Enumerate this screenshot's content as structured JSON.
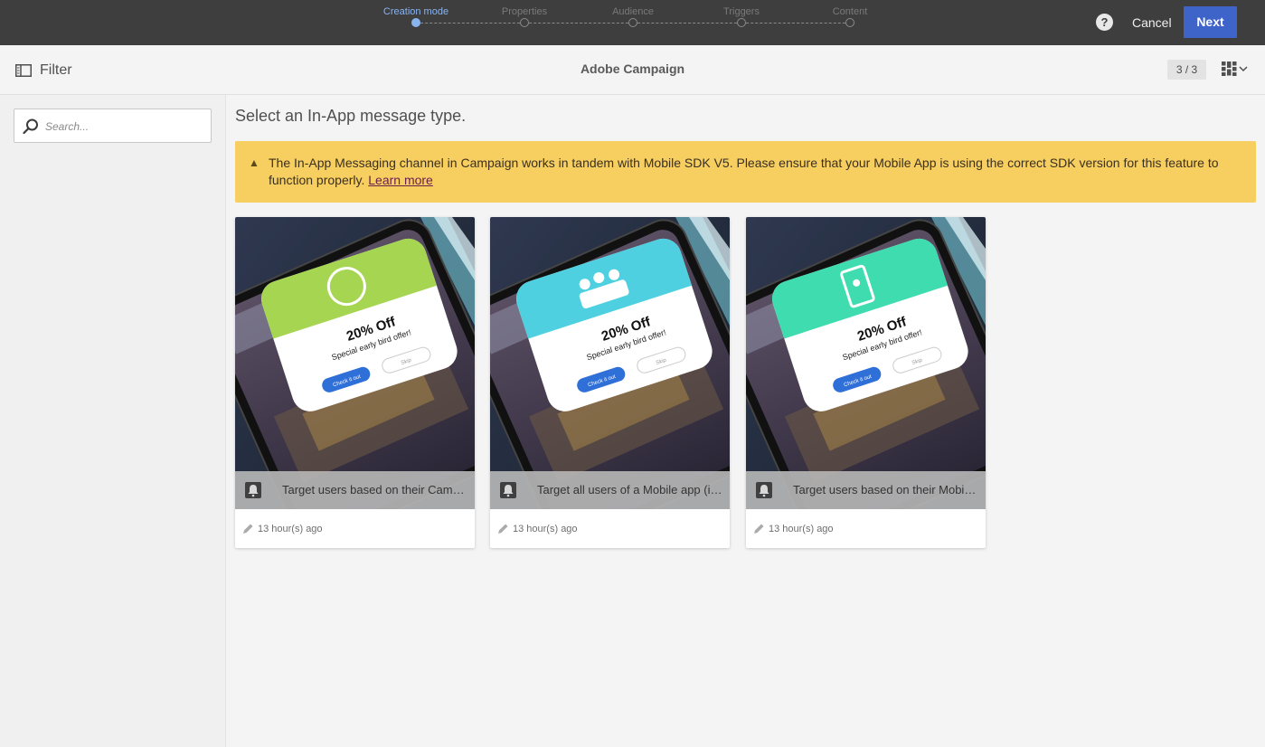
{
  "wizard": {
    "steps": [
      {
        "label": "Creation mode",
        "active": true
      },
      {
        "label": "Properties",
        "active": false
      },
      {
        "label": "Audience",
        "active": false
      },
      {
        "label": "Triggers",
        "active": false
      },
      {
        "label": "Content",
        "active": false
      }
    ],
    "help_label": "?",
    "cancel_label": "Cancel",
    "next_label": "Next"
  },
  "header": {
    "filter_label": "Filter",
    "title": "Adobe Campaign",
    "counter": "3 / 3"
  },
  "sidebar": {
    "search_placeholder": "Search..."
  },
  "main": {
    "heading": "Select an In-App message type.",
    "warning_text": "The In-App Messaging channel in Campaign works in tandem with Mobile SDK V5. Please ensure that your Mobile App is using the correct SDK version for this feature to function properly.",
    "warning_link": "Learn more",
    "cards": [
      {
        "caption": "Target users based on their Campaign profile",
        "meta": "13 hour(s) ago",
        "popup": {
          "header_color": "#a6d651",
          "icon": "profile-link-icon",
          "offer_title": "20% Off",
          "offer_sub": "Special early bird offer!",
          "cta": "Check it out",
          "skip": "Skip"
        }
      },
      {
        "caption": "Target all users of a Mobile app (in-app broadcast)",
        "meta": "13 hour(s) ago",
        "popup": {
          "header_color": "#4fd0e0",
          "icon": "group-users-icon",
          "offer_title": "20% Off",
          "offer_sub": "Special early bird offer!",
          "cta": "Check it out",
          "skip": "Skip"
        }
      },
      {
        "caption": "Target users based on their Mobile profile",
        "meta": "13 hour(s) ago",
        "popup": {
          "header_color": "#3fdcb0",
          "icon": "mobile-profile-icon",
          "offer_title": "20% Off",
          "offer_sub": "Special early bird offer!",
          "cta": "Check it out",
          "skip": "Skip"
        }
      }
    ]
  },
  "colors": {
    "topbar": "#3e3e3e",
    "accent": "#3e63c9",
    "active_step": "#8ab4f0",
    "warning": "#f7ce60"
  }
}
